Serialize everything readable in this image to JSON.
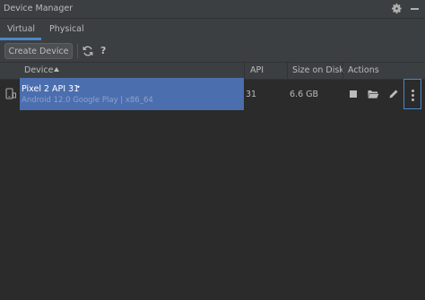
{
  "window": {
    "title": "Device Manager",
    "icons": [
      "gear-icon",
      "hide-icon"
    ]
  },
  "tabs": [
    {
      "label": "Virtual",
      "selected": true
    },
    {
      "label": "Physical",
      "selected": false
    }
  ],
  "toolbar": {
    "create_label": "Create Device",
    "help_label": "?",
    "icons": [
      "refresh-icon"
    ]
  },
  "table": {
    "columns": {
      "device": "Device",
      "api": "API",
      "size": "Size on Disk",
      "actions": "Actions"
    },
    "sort": {
      "column": "Device",
      "direction": "ascending"
    },
    "rows": [
      {
        "name": "Pixel 2 API 31",
        "marker": "•",
        "subtitle": "Android 12.0 Google Play | x86_64",
        "api": "31",
        "size": "6.6 GB",
        "selected": true,
        "action_icons": [
          "stop-icon",
          "folder-icon",
          "edit-icon",
          "more-vertical-icon"
        ]
      }
    ]
  },
  "colors": {
    "background": "#2b2b2b",
    "panel": "#3c3f41",
    "selection": "#4b6eaf",
    "accent": "#4a88c7",
    "text": "#bbbbbb"
  }
}
